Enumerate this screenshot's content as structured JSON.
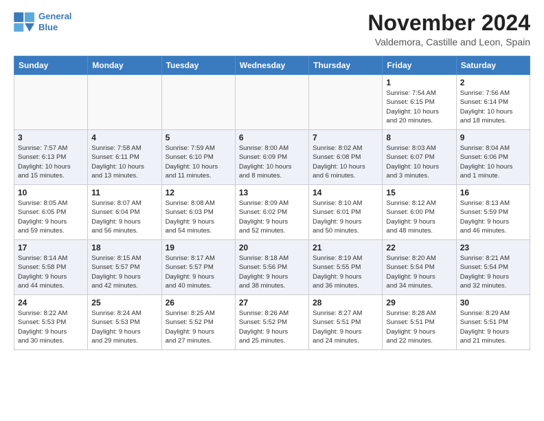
{
  "header": {
    "logo_line1": "General",
    "logo_line2": "Blue",
    "month": "November 2024",
    "location": "Valdemora, Castille and Leon, Spain"
  },
  "weekdays": [
    "Sunday",
    "Monday",
    "Tuesday",
    "Wednesday",
    "Thursday",
    "Friday",
    "Saturday"
  ],
  "weeks": [
    [
      {
        "day": "",
        "info": ""
      },
      {
        "day": "",
        "info": ""
      },
      {
        "day": "",
        "info": ""
      },
      {
        "day": "",
        "info": ""
      },
      {
        "day": "",
        "info": ""
      },
      {
        "day": "1",
        "info": "Sunrise: 7:54 AM\nSunset: 6:15 PM\nDaylight: 10 hours\nand 20 minutes."
      },
      {
        "day": "2",
        "info": "Sunrise: 7:56 AM\nSunset: 6:14 PM\nDaylight: 10 hours\nand 18 minutes."
      }
    ],
    [
      {
        "day": "3",
        "info": "Sunrise: 7:57 AM\nSunset: 6:13 PM\nDaylight: 10 hours\nand 15 minutes."
      },
      {
        "day": "4",
        "info": "Sunrise: 7:58 AM\nSunset: 6:11 PM\nDaylight: 10 hours\nand 13 minutes."
      },
      {
        "day": "5",
        "info": "Sunrise: 7:59 AM\nSunset: 6:10 PM\nDaylight: 10 hours\nand 11 minutes."
      },
      {
        "day": "6",
        "info": "Sunrise: 8:00 AM\nSunset: 6:09 PM\nDaylight: 10 hours\nand 8 minutes."
      },
      {
        "day": "7",
        "info": "Sunrise: 8:02 AM\nSunset: 6:08 PM\nDaylight: 10 hours\nand 6 minutes."
      },
      {
        "day": "8",
        "info": "Sunrise: 8:03 AM\nSunset: 6:07 PM\nDaylight: 10 hours\nand 3 minutes."
      },
      {
        "day": "9",
        "info": "Sunrise: 8:04 AM\nSunset: 6:06 PM\nDaylight: 10 hours\nand 1 minute."
      }
    ],
    [
      {
        "day": "10",
        "info": "Sunrise: 8:05 AM\nSunset: 6:05 PM\nDaylight: 9 hours\nand 59 minutes."
      },
      {
        "day": "11",
        "info": "Sunrise: 8:07 AM\nSunset: 6:04 PM\nDaylight: 9 hours\nand 56 minutes."
      },
      {
        "day": "12",
        "info": "Sunrise: 8:08 AM\nSunset: 6:03 PM\nDaylight: 9 hours\nand 54 minutes."
      },
      {
        "day": "13",
        "info": "Sunrise: 8:09 AM\nSunset: 6:02 PM\nDaylight: 9 hours\nand 52 minutes."
      },
      {
        "day": "14",
        "info": "Sunrise: 8:10 AM\nSunset: 6:01 PM\nDaylight: 9 hours\nand 50 minutes."
      },
      {
        "day": "15",
        "info": "Sunrise: 8:12 AM\nSunset: 6:00 PM\nDaylight: 9 hours\nand 48 minutes."
      },
      {
        "day": "16",
        "info": "Sunrise: 8:13 AM\nSunset: 5:59 PM\nDaylight: 9 hours\nand 46 minutes."
      }
    ],
    [
      {
        "day": "17",
        "info": "Sunrise: 8:14 AM\nSunset: 5:58 PM\nDaylight: 9 hours\nand 44 minutes."
      },
      {
        "day": "18",
        "info": "Sunrise: 8:15 AM\nSunset: 5:57 PM\nDaylight: 9 hours\nand 42 minutes."
      },
      {
        "day": "19",
        "info": "Sunrise: 8:17 AM\nSunset: 5:57 PM\nDaylight: 9 hours\nand 40 minutes."
      },
      {
        "day": "20",
        "info": "Sunrise: 8:18 AM\nSunset: 5:56 PM\nDaylight: 9 hours\nand 38 minutes."
      },
      {
        "day": "21",
        "info": "Sunrise: 8:19 AM\nSunset: 5:55 PM\nDaylight: 9 hours\nand 36 minutes."
      },
      {
        "day": "22",
        "info": "Sunrise: 8:20 AM\nSunset: 5:54 PM\nDaylight: 9 hours\nand 34 minutes."
      },
      {
        "day": "23",
        "info": "Sunrise: 8:21 AM\nSunset: 5:54 PM\nDaylight: 9 hours\nand 32 minutes."
      }
    ],
    [
      {
        "day": "24",
        "info": "Sunrise: 8:22 AM\nSunset: 5:53 PM\nDaylight: 9 hours\nand 30 minutes."
      },
      {
        "day": "25",
        "info": "Sunrise: 8:24 AM\nSunset: 5:53 PM\nDaylight: 9 hours\nand 29 minutes."
      },
      {
        "day": "26",
        "info": "Sunrise: 8:25 AM\nSunset: 5:52 PM\nDaylight: 9 hours\nand 27 minutes."
      },
      {
        "day": "27",
        "info": "Sunrise: 8:26 AM\nSunset: 5:52 PM\nDaylight: 9 hours\nand 25 minutes."
      },
      {
        "day": "28",
        "info": "Sunrise: 8:27 AM\nSunset: 5:51 PM\nDaylight: 9 hours\nand 24 minutes."
      },
      {
        "day": "29",
        "info": "Sunrise: 8:28 AM\nSunset: 5:51 PM\nDaylight: 9 hours\nand 22 minutes."
      },
      {
        "day": "30",
        "info": "Sunrise: 8:29 AM\nSunset: 5:51 PM\nDaylight: 9 hours\nand 21 minutes."
      }
    ]
  ]
}
